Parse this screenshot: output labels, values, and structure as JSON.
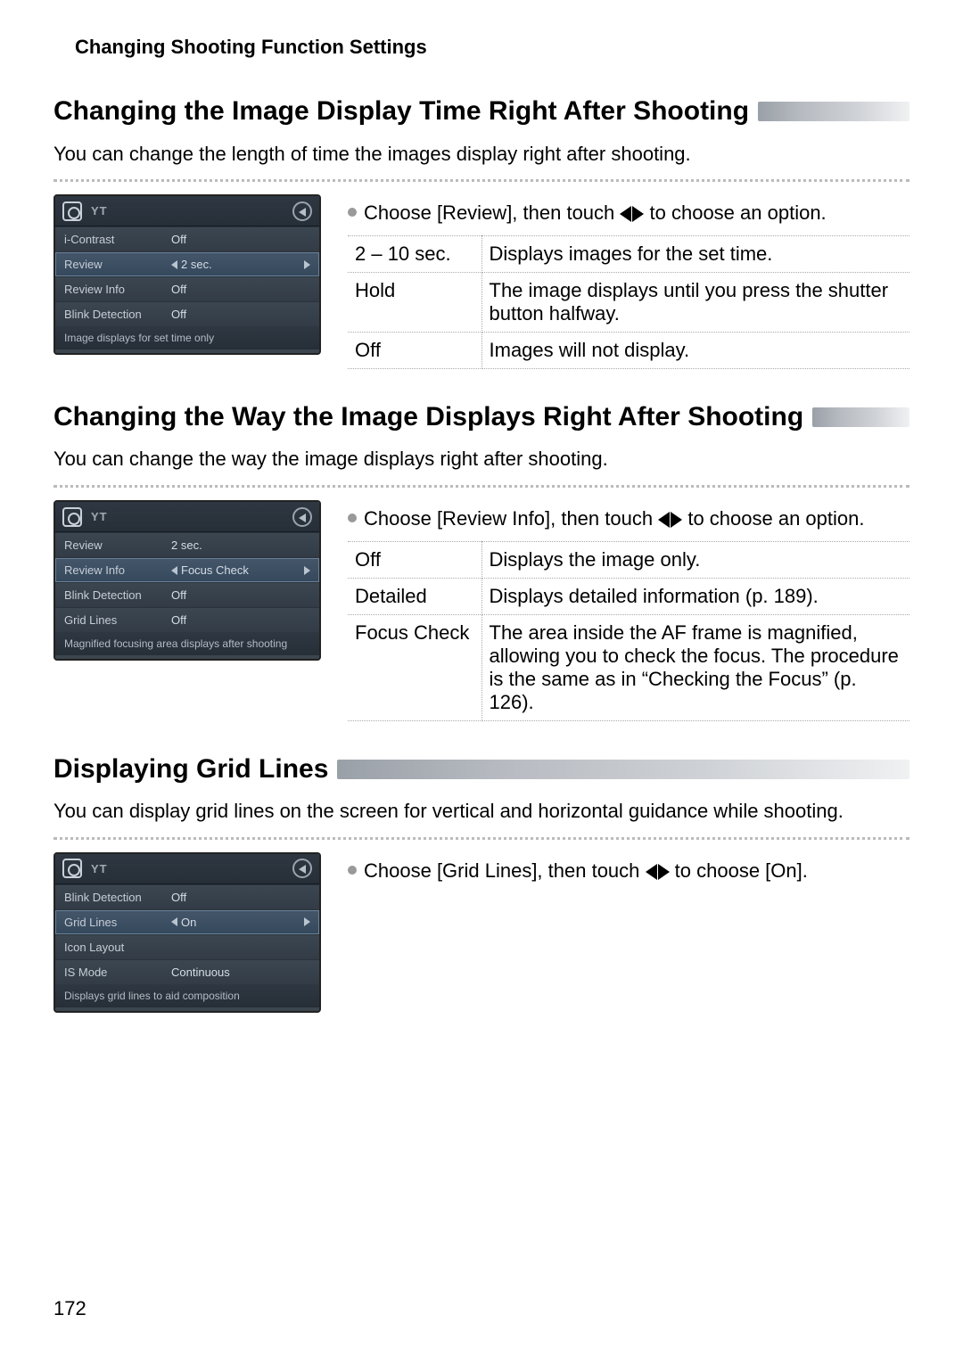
{
  "header": "Changing Shooting Function Settings",
  "page_number": "172",
  "section1": {
    "heading": "Changing the Image Display Time Right After Shooting",
    "intro": "You can change the length of time the images display right after shooting.",
    "bullet_before": "Choose [Review], then touch ",
    "bullet_after": " to choose an option.",
    "table": [
      {
        "key": "2 – 10 sec.",
        "val": "Displays images for the set time."
      },
      {
        "key": "Hold",
        "val": "The image displays until you press the shutter button halfway."
      },
      {
        "key": "Off",
        "val": "Images will not display."
      }
    ],
    "cam": {
      "menu": "YT",
      "rows": [
        {
          "label": "i-Contrast",
          "value": "Off",
          "selected": false
        },
        {
          "label": "Review",
          "value": "2 sec.",
          "selected": true,
          "arrows": true
        },
        {
          "label": "Review Info",
          "value": "Off",
          "selected": false
        },
        {
          "label": "Blink Detection",
          "value": "Off",
          "selected": false
        }
      ],
      "hint": "Image displays for set time only"
    }
  },
  "section2": {
    "heading": "Changing the Way the Image Displays Right After Shooting",
    "intro": "You can change the way the image displays right after shooting.",
    "bullet_before": "Choose [Review Info], then touch ",
    "bullet_after": " to choose an option.",
    "table": [
      {
        "key": "Off",
        "val": "Displays the image only."
      },
      {
        "key": "Detailed",
        "val": "Displays detailed information (p. 189)."
      },
      {
        "key": "Focus Check",
        "val": "The area inside the AF frame is magnified, allowing you to check the focus. The procedure is the same as in “Checking the Focus” (p. 126)."
      }
    ],
    "cam": {
      "menu": "YT",
      "rows": [
        {
          "label": "Review",
          "value": "2 sec.",
          "selected": false
        },
        {
          "label": "Review Info",
          "value": "Focus Check",
          "selected": true,
          "arrows": true
        },
        {
          "label": "Blink Detection",
          "value": "Off",
          "selected": false
        },
        {
          "label": "Grid Lines",
          "value": "Off",
          "selected": false
        }
      ],
      "hint": "Magnified focusing area displays after shooting"
    }
  },
  "section3": {
    "heading": "Displaying Grid Lines",
    "intro": "You can display grid lines on the screen for vertical and horizontal guidance while shooting.",
    "bullet_before": "Choose [Grid Lines], then touch ",
    "bullet_after": " to choose [On].",
    "cam": {
      "menu": "YT",
      "rows": [
        {
          "label": "Blink Detection",
          "value": "Off",
          "selected": false
        },
        {
          "label": "Grid Lines",
          "value": "On",
          "selected": true,
          "arrows": true
        },
        {
          "label": "Icon Layout",
          "value": "",
          "selected": false
        },
        {
          "label": "IS Mode",
          "value": "Continuous",
          "selected": false
        }
      ],
      "hint": "Displays grid lines to aid composition"
    }
  }
}
